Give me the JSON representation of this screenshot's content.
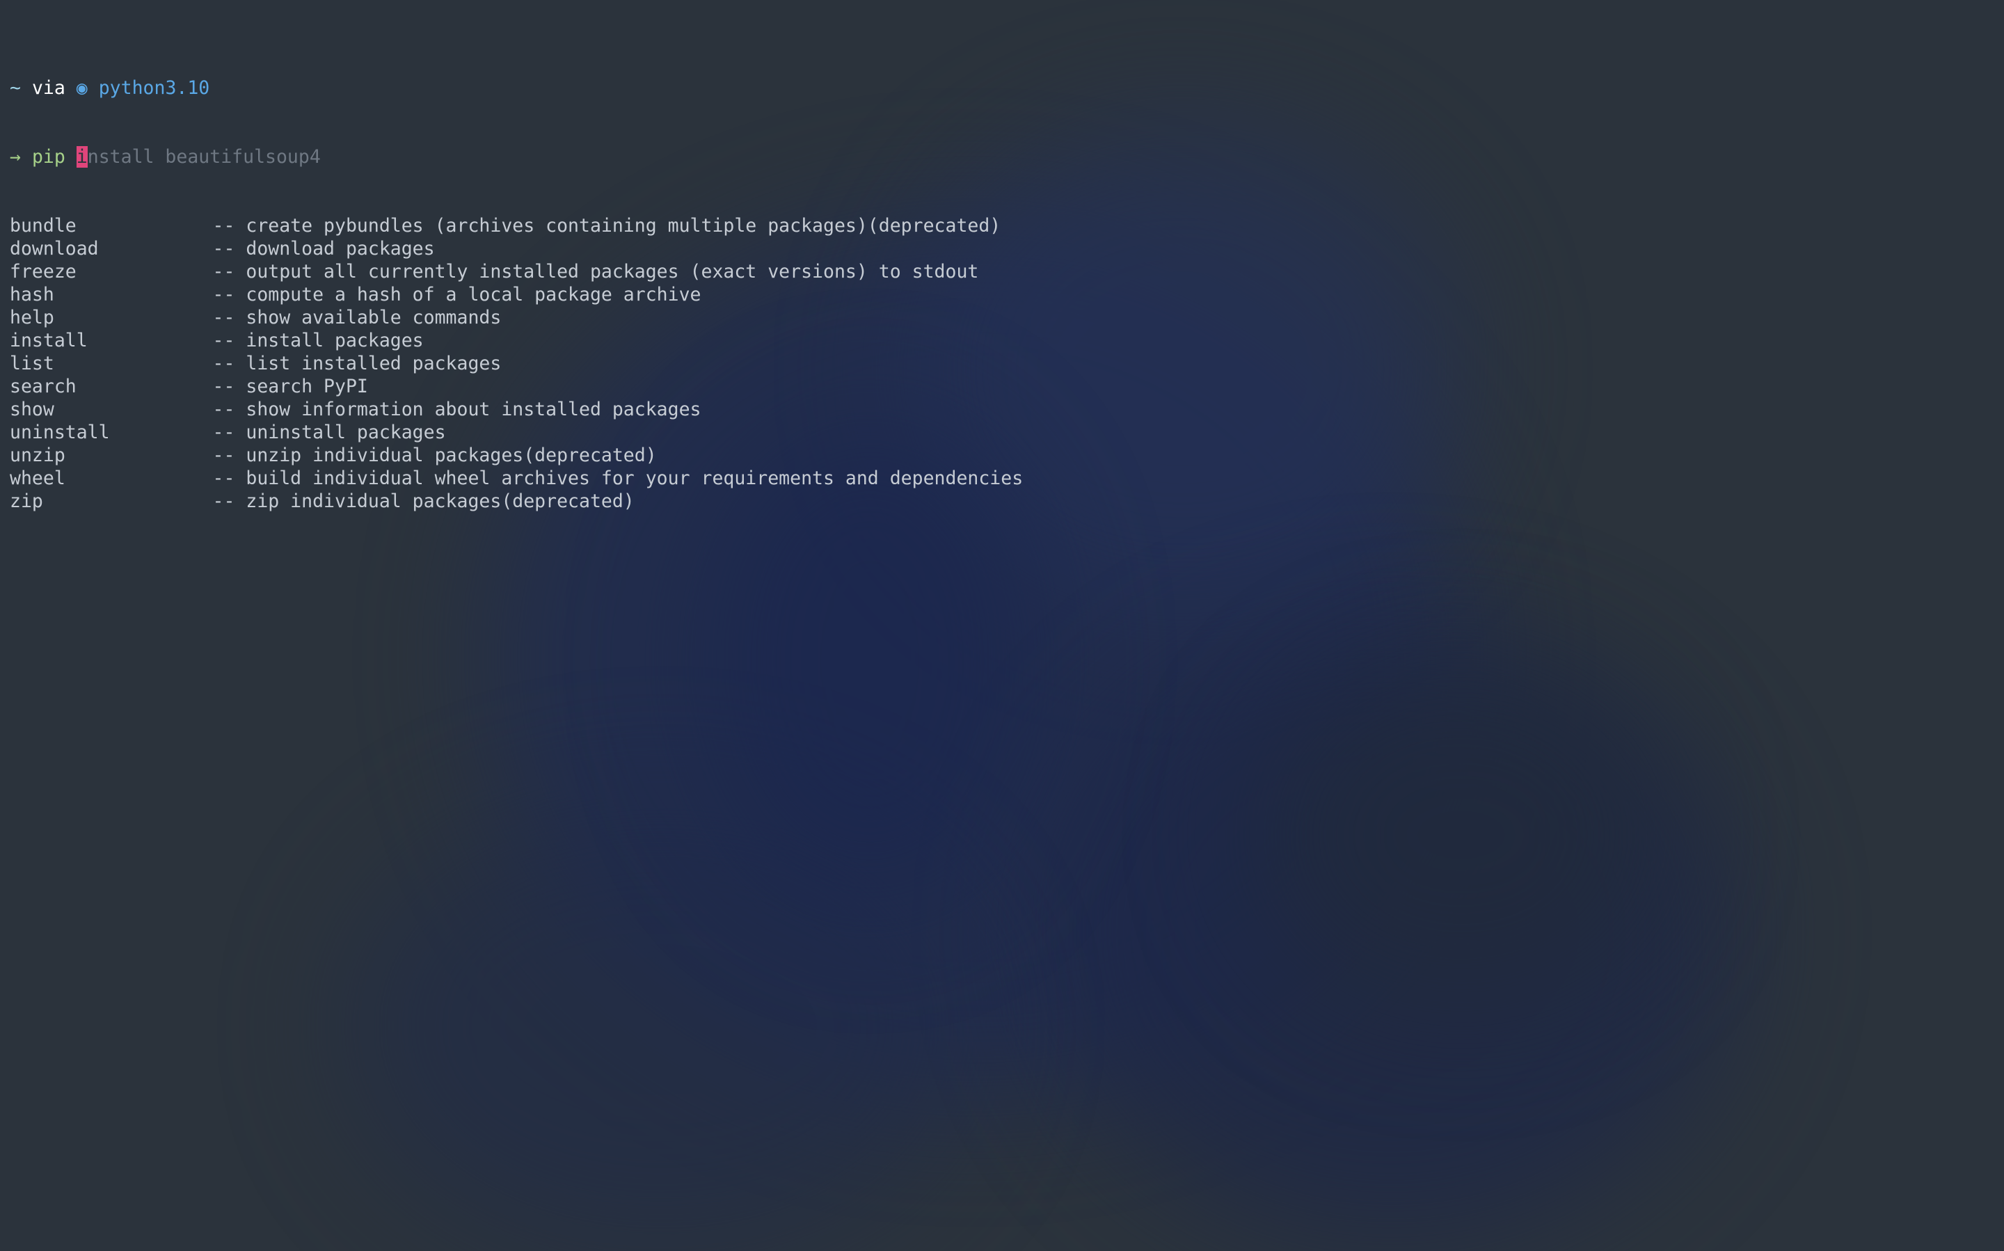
{
  "prompt": {
    "dir": "~",
    "via": "via",
    "python_icon": "python-icon",
    "python_icon_glyph": "◉",
    "python_version": "python3.10"
  },
  "input_line": {
    "arrow": "→",
    "command": "pip",
    "cursor_char": "i",
    "suggestion": "nstall beautifulsoup4"
  },
  "completions": [
    {
      "name": "bundle",
      "desc": "-- create pybundles (archives containing multiple packages)(deprecated)"
    },
    {
      "name": "download",
      "desc": "-- download packages"
    },
    {
      "name": "freeze",
      "desc": "-- output all currently installed packages (exact versions) to stdout"
    },
    {
      "name": "hash",
      "desc": "-- compute a hash of a local package archive"
    },
    {
      "name": "help",
      "desc": "-- show available commands"
    },
    {
      "name": "install",
      "desc": "-- install packages"
    },
    {
      "name": "list",
      "desc": "-- list installed packages"
    },
    {
      "name": "search",
      "desc": "-- search PyPI"
    },
    {
      "name": "show",
      "desc": "-- show information about installed packages"
    },
    {
      "name": "uninstall",
      "desc": "-- uninstall packages"
    },
    {
      "name": "unzip",
      "desc": "-- unzip individual packages(deprecated)"
    },
    {
      "name": "wheel",
      "desc": "-- build individual wheel archives for your requirements and dependencies"
    },
    {
      "name": "zip",
      "desc": "-- zip individual packages(deprecated)"
    }
  ],
  "colors": {
    "background": "#2b333c",
    "text": "#c6ccd4",
    "python": "#5aa8e6",
    "command": "#a6d189",
    "cursor": "#e0457b",
    "suggestion": "#6f7883"
  }
}
